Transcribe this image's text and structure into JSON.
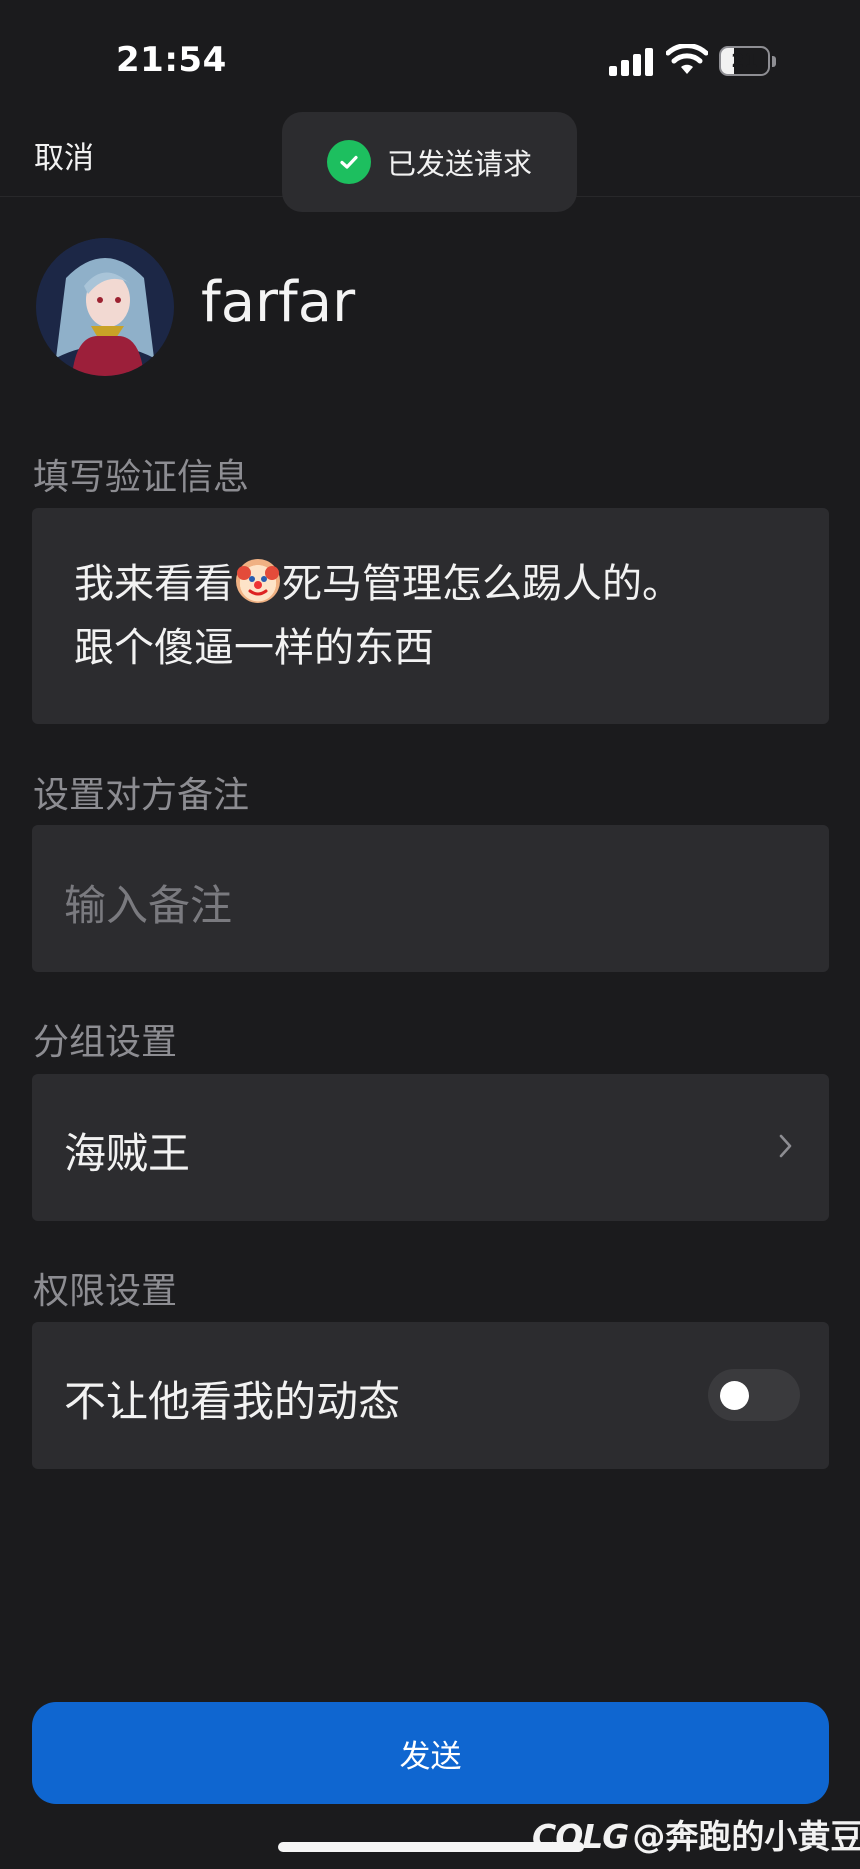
{
  "status_bar": {
    "time": "21:54",
    "battery_level": "21",
    "icons": [
      "cellular-signal-icon",
      "wifi-icon",
      "battery-icon"
    ]
  },
  "header": {
    "cancel_label": "取消"
  },
  "toast": {
    "icon": "check-circle-icon",
    "text": "已发送请求",
    "color": "#1dbf5f"
  },
  "profile": {
    "username": "farfar"
  },
  "verify_section": {
    "label": "填写验证信息",
    "message_line1_before_emoji": "我来看看",
    "emoji": "clown-face-emoji",
    "message_line1_after_emoji": "死马管理怎么踢人的。",
    "message_line2": "跟个傻逼一样的东西"
  },
  "remark_section": {
    "label": "设置对方备注",
    "placeholder": "输入备注",
    "value": ""
  },
  "group_section": {
    "label": "分组设置",
    "value": "海贼王",
    "icon": "chevron-right-icon"
  },
  "permission_section": {
    "label": "权限设置",
    "option_label": "不让他看我的动态",
    "toggle_on": false
  },
  "send_button": {
    "label": "发送",
    "color": "#0f66d0"
  },
  "watermark": {
    "logo": "COLG",
    "text": "@奔跑的小黄豆"
  }
}
